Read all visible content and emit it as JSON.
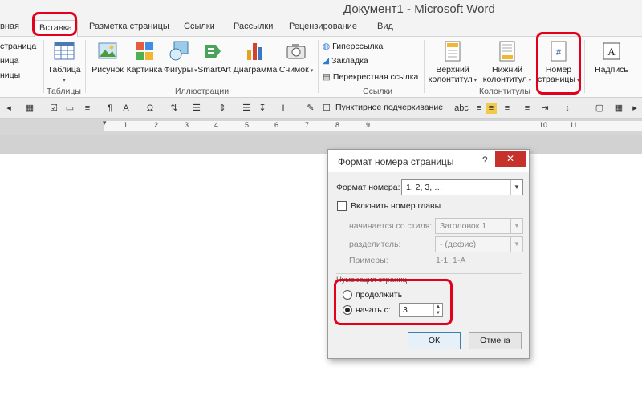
{
  "window": {
    "title": "Документ1 - Microsoft Word"
  },
  "tabs": [
    "вная",
    "Вставка",
    "Разметка страницы",
    "Ссылки",
    "Рассылки",
    "Рецензирование",
    "Вид"
  ],
  "ribbon": {
    "pages_group": {
      "items": [
        "страница",
        "ница",
        "ницы"
      ]
    },
    "tables": {
      "button": "Таблица",
      "label": "Таблицы"
    },
    "illustrations": {
      "label": "Иллюстрации",
      "buttons": [
        "Рисунок",
        "Картинка",
        "Фигуры",
        "SmartArt",
        "Диаграмма",
        "Снимок"
      ]
    },
    "links": {
      "label": "Ссылки",
      "items": [
        "Гиперссылка",
        "Закладка",
        "Перекрестная ссылка"
      ]
    },
    "header_footer": {
      "label": "Колонтитулы",
      "header": [
        "Верхний",
        "колонтитул"
      ],
      "footer": [
        "Нижний",
        "колонтитул"
      ],
      "page_number": [
        "Номер",
        "страницы"
      ]
    },
    "text": {
      "caption": [
        "Надпись"
      ]
    }
  },
  "format_toolbar": {
    "underline_label": "Пунктирное подчеркивание"
  },
  "ruler": {
    "numbers": [
      "1",
      "2",
      "3",
      "4",
      "5",
      "6",
      "7",
      "8",
      "9",
      "10",
      "11"
    ]
  },
  "dialog": {
    "title": "Формат номера страницы",
    "help": "?",
    "close": "✕",
    "number_format_label": "Формат номера:",
    "number_format_value": "1, 2, 3, …",
    "include_chapter_label": "Включить номер главы",
    "include_chapter_checked": false,
    "style_label": "начинается со стиля:",
    "style_value": "Заголовок 1",
    "separator_label": "разделитель:",
    "separator_value": "-   (дефис)",
    "examples_label": "Примеры:",
    "examples_value": "1-1, 1-A",
    "numbering_label": "Нумерация страниц",
    "continue_label": "продолжить",
    "start_label": "начать с:",
    "start_value": "3",
    "selected_option": "start",
    "ok_label": "ОК",
    "cancel_label": "Отмена"
  },
  "colors": {
    "highlight": "#e3001b",
    "close": "#c7312b"
  }
}
